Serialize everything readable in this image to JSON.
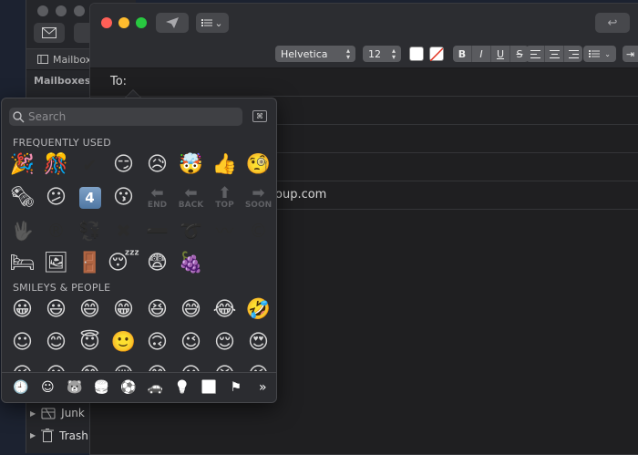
{
  "main_window": {
    "tab_label": "Mailboxes",
    "sidebar_heading": "Mailboxes",
    "mailboxes": [
      {
        "label": "Junk"
      },
      {
        "label": "Trash"
      }
    ]
  },
  "compose": {
    "font_family": "Helvetica",
    "font_size": "12",
    "style_buttons": [
      "B",
      "I",
      "U",
      "S"
    ],
    "to_label": "To:",
    "to_value": "",
    "field_fragment": "oup.com"
  },
  "picker": {
    "search_placeholder": "Search",
    "sections": {
      "frequent": "FREQUENTLY USED",
      "smileys": "SMILEYS & PEOPLE"
    },
    "frequent_rows": [
      [
        "🎉",
        "🎊",
        "✔",
        "😏",
        "😥",
        "🤯",
        "👍",
        "🧐"
      ],
      [
        "🗞",
        "😕",
        "4",
        "😗",
        "END",
        "BACK",
        "TOP",
        "SOON"
      ],
      [
        "🖖",
        "®",
        "💱",
        "✖",
        "➖",
        "➰",
        "〰",
        "©"
      ],
      [
        "🛏",
        "🖼",
        "🚪",
        "😴",
        "😨",
        "🍇"
      ]
    ],
    "smiley_rows": [
      [
        "😀",
        "😃",
        "😄",
        "😁",
        "😆",
        "😅",
        "😂",
        "🤣"
      ],
      [
        "☺",
        "😊",
        "😇",
        "🙂",
        "🙃",
        "😉",
        "😌",
        "😍"
      ],
      [
        "😘",
        "😗",
        "😙",
        "😚",
        "😋",
        "😛",
        "😝",
        "😜"
      ]
    ],
    "categories": [
      {
        "icon": "clock-icon",
        "glyph": "🕘"
      },
      {
        "icon": "smiley-icon",
        "glyph": "☺"
      },
      {
        "icon": "bear-icon",
        "glyph": "🐻"
      },
      {
        "icon": "food-icon",
        "glyph": "🍔"
      },
      {
        "icon": "ball-icon",
        "glyph": "⚽"
      },
      {
        "icon": "car-icon",
        "glyph": "🚗"
      },
      {
        "icon": "bulb-icon",
        "glyph": "💡"
      },
      {
        "icon": "symbols-icon",
        "glyph": "🔣"
      },
      {
        "icon": "flag-icon",
        "glyph": "⚑"
      },
      {
        "icon": "more-icon",
        "glyph": "»"
      }
    ]
  },
  "colors": {
    "accent": "#4da3ff",
    "close": "#fe5f57",
    "minimize": "#febc2e",
    "zoom": "#28c840"
  }
}
